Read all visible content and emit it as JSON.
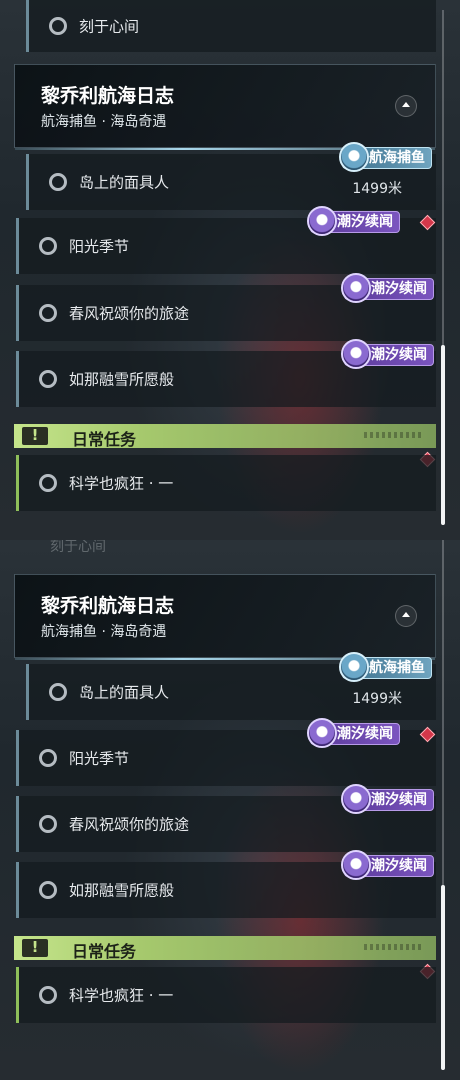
{
  "quest_above": "刻于心间",
  "faded_above": "刻于心间",
  "journal": {
    "title": "黎乔利航海日志",
    "subtitle": "航海捕鱼 · 海岛奇遇"
  },
  "quests": [
    {
      "label": "岛上的面具人",
      "distance": "1499米",
      "tag": "航海捕鱼"
    },
    {
      "label": "阳光季节",
      "tag": "潮汐续闻"
    },
    {
      "label": "春风祝颂你的旅途",
      "tag": "潮汐续闻"
    },
    {
      "label": "如那融雪所愿般",
      "tag": "潮汐续闻"
    }
  ],
  "daily": {
    "title": "日常任务",
    "quests": [
      {
        "label": "科学也疯狂 · 一"
      }
    ]
  },
  "colors": {
    "tidal_tag": "#6b48b0",
    "fishing_tag": "#5b95b4",
    "daily_accent": "#b8d97c",
    "alert_diamond": "#d4374a"
  },
  "icons": [
    "radio-circle-icon",
    "collapse-arrow-icon",
    "quest-badge-icon",
    "alert-diamond-icon",
    "exclamation-icon"
  ]
}
